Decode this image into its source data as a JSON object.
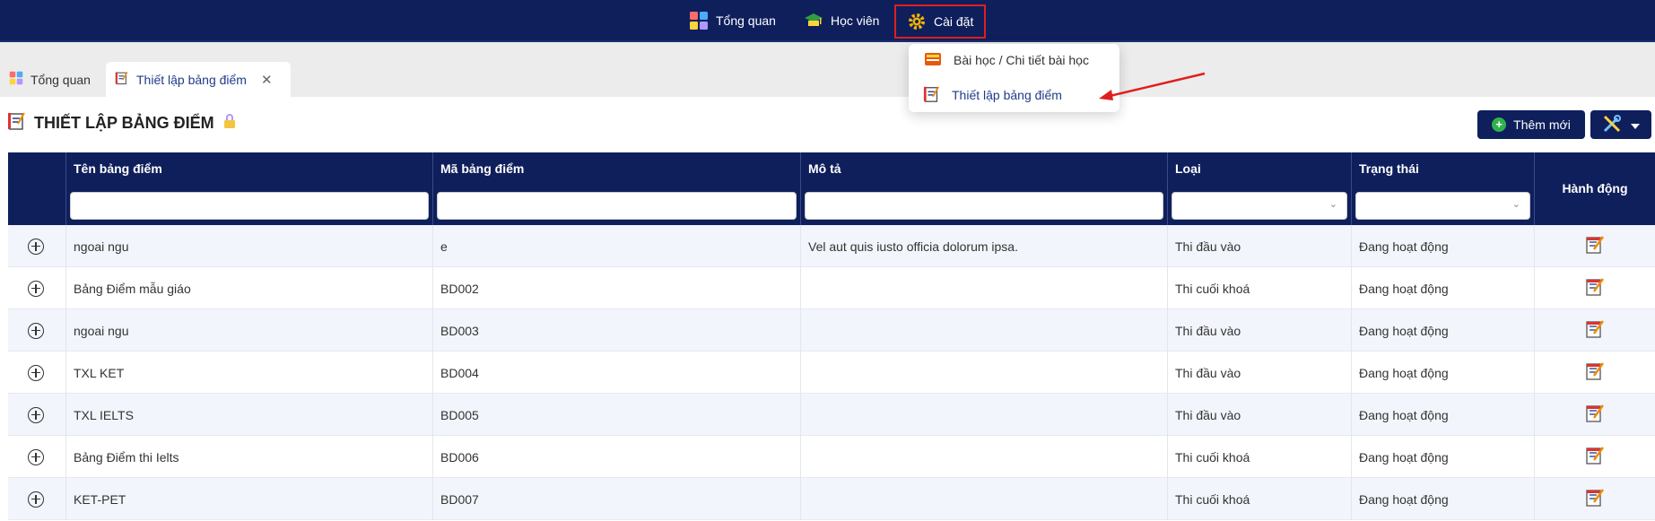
{
  "nav": {
    "items": [
      {
        "label": "Tổng quan",
        "icon": "dashboard-icon"
      },
      {
        "label": "Học viên",
        "icon": "graduation-cap-icon"
      },
      {
        "label": "Cài đặt",
        "icon": "gear-icon"
      }
    ]
  },
  "dropdown": {
    "items": [
      {
        "label": "Bài học / Chi tiết bài học",
        "icon": "book-icon"
      },
      {
        "label": "Thiết lập bảng điểm",
        "icon": "notepad-icon"
      }
    ]
  },
  "tabs": [
    {
      "label": "Tổng quan",
      "icon": "dashboard-icon"
    },
    {
      "label": "Thiết lập bảng điểm",
      "icon": "notepad-icon",
      "close": "✕"
    }
  ],
  "page": {
    "title": "THIẾT LẬP BẢNG ĐIỂM",
    "add_label": "Thêm mới"
  },
  "table": {
    "columns": [
      "Tên bảng điểm",
      "Mã bảng điểm",
      "Mô tả",
      "Loại",
      "Trạng thái",
      "Hành động"
    ],
    "rows": [
      {
        "name": "ngoai ngu",
        "code": "e",
        "desc": "Vel aut quis iusto officia dolorum ipsa.",
        "type": "Thi đầu vào",
        "status": "Đang hoạt động"
      },
      {
        "name": "Bảng Điểm mẫu giáo",
        "code": "BD002",
        "desc": "",
        "type": "Thi cuối khoá",
        "status": "Đang hoạt động"
      },
      {
        "name": "ngoai ngu",
        "code": "BD003",
        "desc": "",
        "type": "Thi đầu vào",
        "status": "Đang hoạt động"
      },
      {
        "name": "TXL KET",
        "code": "BD004",
        "desc": "",
        "type": "Thi đầu vào",
        "status": "Đang hoạt động"
      },
      {
        "name": "TXL IELTS",
        "code": "BD005",
        "desc": "",
        "type": "Thi đầu vào",
        "status": "Đang hoạt động"
      },
      {
        "name": "Bảng Điểm thi Ielts",
        "code": "BD006",
        "desc": "",
        "type": "Thi cuối khoá",
        "status": "Đang hoạt động"
      },
      {
        "name": "KET-PET",
        "code": "BD007",
        "desc": "",
        "type": "Thi cuối khoá",
        "status": "Đang hoạt động"
      }
    ]
  },
  "colors": {
    "navy": "#0f1f5c",
    "highlight_red": "#e01e1e",
    "add_green": "#2fb24a"
  }
}
